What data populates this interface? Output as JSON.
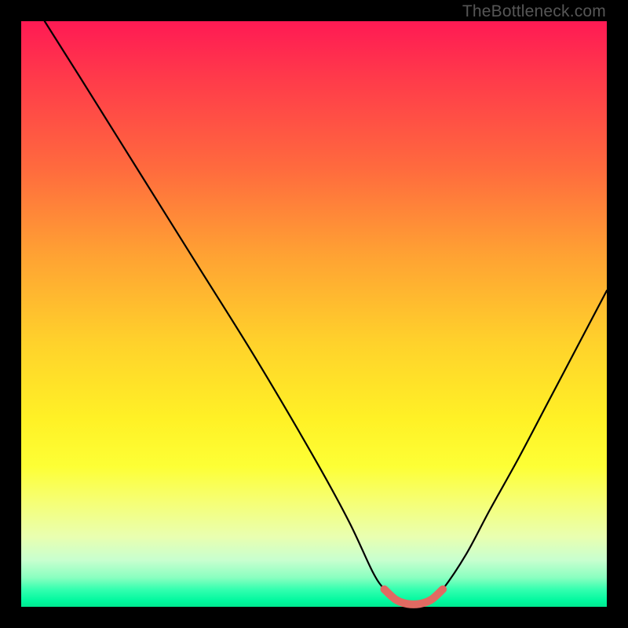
{
  "watermark": "TheBottleneck.com",
  "chart_data": {
    "type": "line",
    "title": "",
    "xlabel": "",
    "ylabel": "",
    "xlim": [
      0,
      100
    ],
    "ylim": [
      0,
      100
    ],
    "grid": false,
    "series": [
      {
        "name": "curve",
        "color": "#000000",
        "x": [
          4,
          10,
          20,
          30,
          40,
          50,
          56,
          60,
          62,
          64,
          66,
          68,
          70,
          72,
          76,
          80,
          85,
          90,
          95,
          100
        ],
        "y": [
          100,
          90.5,
          74.5,
          58.5,
          42.5,
          25.5,
          14.5,
          6.0,
          3.0,
          1.2,
          0.5,
          0.5,
          1.2,
          3.0,
          9.0,
          16.5,
          25.5,
          35.0,
          44.5,
          54.0
        ]
      },
      {
        "name": "highlight-band",
        "color": "#e16a62",
        "x": [
          62,
          64,
          66,
          68,
          70,
          72
        ],
        "y": [
          3.0,
          1.2,
          0.5,
          0.5,
          1.2,
          3.0
        ]
      }
    ],
    "background_gradient": {
      "top": "#ff1a54",
      "mid": "#ffd22b",
      "bottom": "#00e890"
    }
  }
}
